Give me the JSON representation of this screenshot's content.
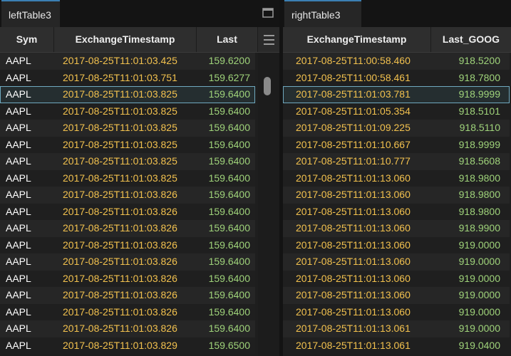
{
  "left": {
    "tab_label": "leftTable3",
    "columns": [
      "Sym",
      "ExchangeTimestamp",
      "Last"
    ],
    "rows": [
      [
        "AAPL",
        "2017-08-25T11:01:03.425",
        "159.6200"
      ],
      [
        "AAPL",
        "2017-08-25T11:01:03.751",
        "159.6277"
      ],
      [
        "AAPL",
        "2017-08-25T11:01:03.825",
        "159.6400"
      ],
      [
        "AAPL",
        "2017-08-25T11:01:03.825",
        "159.6400"
      ],
      [
        "AAPL",
        "2017-08-25T11:01:03.825",
        "159.6400"
      ],
      [
        "AAPL",
        "2017-08-25T11:01:03.825",
        "159.6400"
      ],
      [
        "AAPL",
        "2017-08-25T11:01:03.825",
        "159.6400"
      ],
      [
        "AAPL",
        "2017-08-25T11:01:03.825",
        "159.6400"
      ],
      [
        "AAPL",
        "2017-08-25T11:01:03.826",
        "159.6400"
      ],
      [
        "AAPL",
        "2017-08-25T11:01:03.826",
        "159.6400"
      ],
      [
        "AAPL",
        "2017-08-25T11:01:03.826",
        "159.6400"
      ],
      [
        "AAPL",
        "2017-08-25T11:01:03.826",
        "159.6400"
      ],
      [
        "AAPL",
        "2017-08-25T11:01:03.826",
        "159.6400"
      ],
      [
        "AAPL",
        "2017-08-25T11:01:03.826",
        "159.6400"
      ],
      [
        "AAPL",
        "2017-08-25T11:01:03.826",
        "159.6400"
      ],
      [
        "AAPL",
        "2017-08-25T11:01:03.826",
        "159.6400"
      ],
      [
        "AAPL",
        "2017-08-25T11:01:03.826",
        "159.6400"
      ],
      [
        "AAPL",
        "2017-08-25T11:01:03.829",
        "159.6500"
      ]
    ],
    "selected_row": 2
  },
  "right": {
    "tab_label": "rightTable3",
    "columns": [
      "ExchangeTimestamp",
      "Last_GOOG"
    ],
    "rows": [
      [
        "2017-08-25T11:00:58.460",
        "918.5200"
      ],
      [
        "2017-08-25T11:00:58.461",
        "918.7800"
      ],
      [
        "2017-08-25T11:01:03.781",
        "918.9999"
      ],
      [
        "2017-08-25T11:01:05.354",
        "918.5101"
      ],
      [
        "2017-08-25T11:01:09.225",
        "918.5110"
      ],
      [
        "2017-08-25T11:01:10.667",
        "918.9999"
      ],
      [
        "2017-08-25T11:01:10.777",
        "918.5608"
      ],
      [
        "2017-08-25T11:01:13.060",
        "918.9800"
      ],
      [
        "2017-08-25T11:01:13.060",
        "918.9800"
      ],
      [
        "2017-08-25T11:01:13.060",
        "918.9800"
      ],
      [
        "2017-08-25T11:01:13.060",
        "918.9900"
      ],
      [
        "2017-08-25T11:01:13.060",
        "919.0000"
      ],
      [
        "2017-08-25T11:01:13.060",
        "919.0000"
      ],
      [
        "2017-08-25T11:01:13.060",
        "919.0000"
      ],
      [
        "2017-08-25T11:01:13.060",
        "919.0000"
      ],
      [
        "2017-08-25T11:01:13.060",
        "919.0000"
      ],
      [
        "2017-08-25T11:01:13.061",
        "919.0000"
      ],
      [
        "2017-08-25T11:01:13.061",
        "919.0400"
      ]
    ],
    "selected_row": 2
  },
  "icons": {
    "maximize": "maximize-icon",
    "column_menu": "hamburger-menu-icon"
  },
  "colors": {
    "timestamp": "#f2c14e",
    "number": "#9fd37a",
    "selection": "#6fa9bf",
    "tab_accent": "#3b7fb3"
  }
}
